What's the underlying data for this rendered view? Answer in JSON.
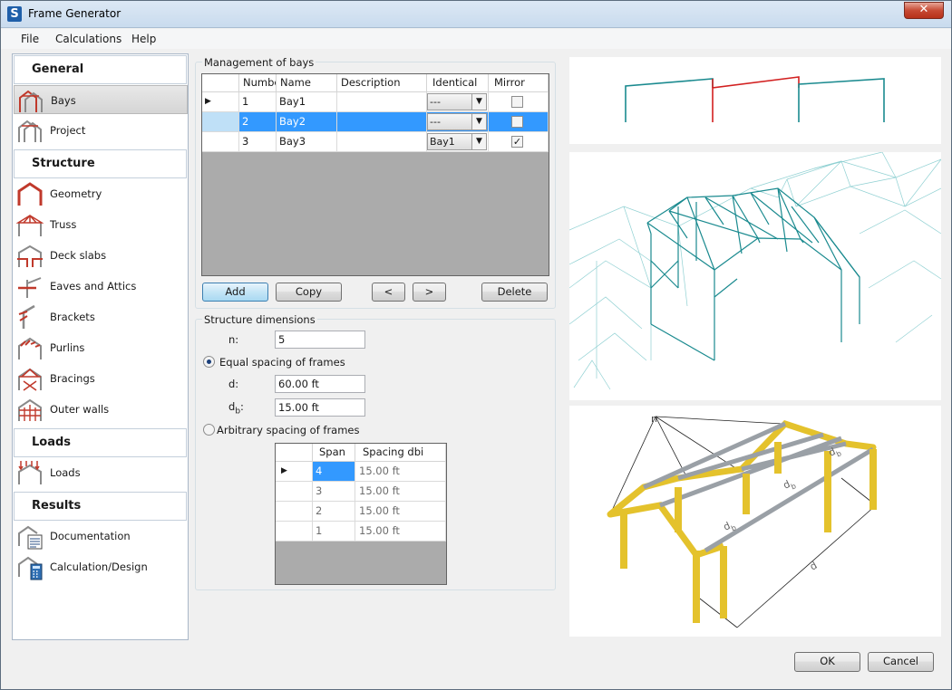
{
  "window": {
    "title": "Frame Generator",
    "close_glyph": "✕"
  },
  "menu": [
    "File",
    "Calculations",
    "Help"
  ],
  "sidebar": {
    "sections": [
      {
        "title": "General",
        "items": [
          {
            "label": "Bays",
            "icon": "bays-icon",
            "selected": true
          },
          {
            "label": "Project",
            "icon": "project-icon"
          }
        ]
      },
      {
        "title": "Structure",
        "items": [
          {
            "label": "Geometry",
            "icon": "geometry-icon"
          },
          {
            "label": "Truss",
            "icon": "truss-icon"
          },
          {
            "label": "Deck slabs",
            "icon": "deck-slabs-icon"
          },
          {
            "label": "Eaves and Attics",
            "icon": "eaves-icon"
          },
          {
            "label": "Brackets",
            "icon": "brackets-icon"
          },
          {
            "label": "Purlins",
            "icon": "purlins-icon"
          },
          {
            "label": "Bracings",
            "icon": "bracings-icon"
          },
          {
            "label": "Outer walls",
            "icon": "outer-walls-icon"
          }
        ]
      },
      {
        "title": "Loads",
        "items": [
          {
            "label": "Loads",
            "icon": "loads-icon"
          }
        ]
      },
      {
        "title": "Results",
        "items": [
          {
            "label": "Documentation",
            "icon": "documentation-icon"
          },
          {
            "label": "Calculation/Design",
            "icon": "calculation-icon"
          }
        ]
      }
    ]
  },
  "bays": {
    "group_title": "Management of bays",
    "columns": [
      "Numbe",
      "Name",
      "Description",
      "Identical",
      "Mirror"
    ],
    "rows": [
      {
        "number": "1",
        "name": "Bay1",
        "description": "",
        "identical": "---",
        "mirror": false,
        "selected": false,
        "current": true
      },
      {
        "number": "2",
        "name": "Bay2",
        "description": "",
        "identical": "---",
        "mirror": false,
        "selected": true,
        "current": false
      },
      {
        "number": "3",
        "name": "Bay3",
        "description": "",
        "identical": "Bay1",
        "mirror": true,
        "selected": false,
        "current": false
      }
    ],
    "buttons": {
      "add": "Add",
      "copy": "Copy",
      "prev": "<",
      "next": ">",
      "delete": "Delete"
    }
  },
  "dimensions": {
    "group_title": "Structure dimensions",
    "n_label": "n:",
    "n_value": "5",
    "equal_label": "Equal spacing of frames",
    "equal_selected": true,
    "d_label": "d:",
    "d_value": "60.00 ft",
    "db_label": "d",
    "db_sub": "b",
    "db_colon": ":",
    "db_value": "15.00 ft",
    "arbitrary_label": "Arbitrary spacing of frames",
    "arbitrary_selected": false,
    "span_columns": [
      "Span",
      "Spacing dbi"
    ],
    "spans": [
      {
        "span": "4",
        "spacing": "15.00 ft",
        "current": true
      },
      {
        "span": "3",
        "spacing": "15.00 ft",
        "current": false
      },
      {
        "span": "2",
        "spacing": "15.00 ft",
        "current": false
      },
      {
        "span": "1",
        "spacing": "15.00 ft",
        "current": false
      }
    ]
  },
  "preview_labels": {
    "n": "n",
    "db1": "d",
    "db1_sub": "b",
    "db2": "d",
    "db2_sub": "b",
    "db3": "d",
    "db3_sub": "b",
    "d": "d"
  },
  "colors": {
    "accent_select": "#3399ff",
    "frame_teal": "#1a8a8f",
    "frame_red": "#d22020",
    "timber": "#e4c22c"
  },
  "footer": {
    "ok": "OK",
    "cancel": "Cancel"
  }
}
